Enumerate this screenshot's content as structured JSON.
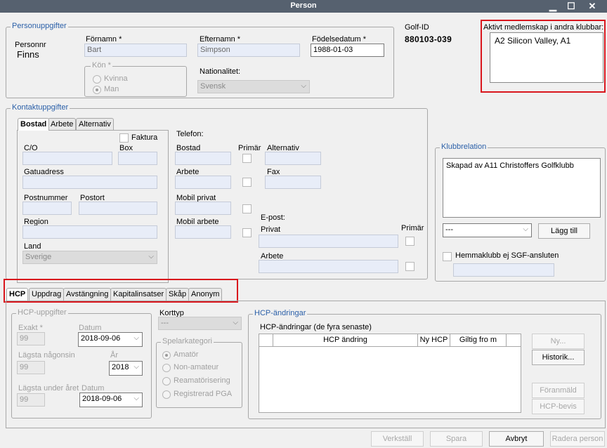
{
  "window": {
    "title": "Person",
    "min": "▁",
    "max": "☐",
    "close": "✕"
  },
  "person": {
    "legend": "Personuppgifter",
    "personnr_label": "Personnr",
    "personnr_value": "Finns",
    "fornamn_label": "Förnamn *",
    "fornamn": "Bart",
    "efternamn_label": "Efternamn *",
    "efternamn": "Simpson",
    "fodelsedatum_label": "Födelsedatum *",
    "fodelsedatum": "1988-01-03",
    "kon_label": "Kön *",
    "kvinna": "Kvinna",
    "man": "Man",
    "nationalitet_label": "Nationalitet:",
    "nationalitet": "Svensk",
    "golfid_label": "Golf-ID",
    "golfid": "880103-039",
    "memberships_label": "Aktivt medlemskap i andra klubbar:",
    "memberships": "A2 Silicon Valley, A1"
  },
  "contact": {
    "legend": "Kontaktuppgifter",
    "tabs": [
      "Bostad",
      "Arbete",
      "Alternativ"
    ],
    "faktura": "Faktura",
    "co": "C/O",
    "box": "Box",
    "gatuadress": "Gatuadress",
    "postnummer": "Postnummer",
    "postort": "Postort",
    "region": "Region",
    "land": "Land",
    "land_value": "Sverige",
    "telefon": "Telefon:",
    "tel_bostad": "Bostad",
    "primar": "Primär",
    "alternativ": "Alternativ",
    "tel_arbete": "Arbete",
    "fax": "Fax",
    "mobil_privat": "Mobil privat",
    "mobil_arbete": "Mobil arbete",
    "epost": "E-post:",
    "privat": "Privat",
    "epost_arbete": "Arbete",
    "epost_primar": "Primär"
  },
  "club": {
    "legend": "Klubbrelation",
    "text": "Skapad av A11 Christoffers Golfklubb",
    "select": "---",
    "add": "Lägg till",
    "hemmaklubb": "Hemmaklubb ej SGF-ansluten"
  },
  "tabs": [
    "HCP",
    "Uppdrag",
    "Avstängning",
    "Kapitalinsatser",
    "Skåp",
    "Anonym"
  ],
  "hcp": {
    "legend": "HCP-uppgifter",
    "exakt": "Exakt *",
    "exakt_val": "99",
    "datum": "Datum",
    "datum_val": "2018-09-06",
    "lagsta": "Lägsta någonsin",
    "lagsta_val": "99",
    "ar": "År",
    "ar_val": "2018",
    "lagsta_aret": "Lägsta under året",
    "datum2": "Datum",
    "lagsta_aret_val": "99",
    "datum2_val": "2018-09-06",
    "korttyp": "Korttyp",
    "korttyp_val": "---",
    "spelarkategori": "Spelarkategori",
    "amator": "Amatör",
    "nonamateur": "Non-amateur",
    "reamator": "Reamatörisering",
    "pga": "Registrerad PGA"
  },
  "changes": {
    "legend": "HCP-ändringar",
    "title": "HCP-ändringar (de fyra senaste)",
    "columns": [
      "HCP ändring",
      "Ny HCP",
      "Giltig fro m"
    ],
    "ny": "Ny...",
    "historik": "Historik...",
    "foranmald": "Föranmäld",
    "bevis": "HCP-bevis"
  },
  "footer": {
    "verkstall": "Verkställ",
    "spara": "Spara",
    "avbryt": "Avbryt",
    "radera": "Radera person"
  }
}
